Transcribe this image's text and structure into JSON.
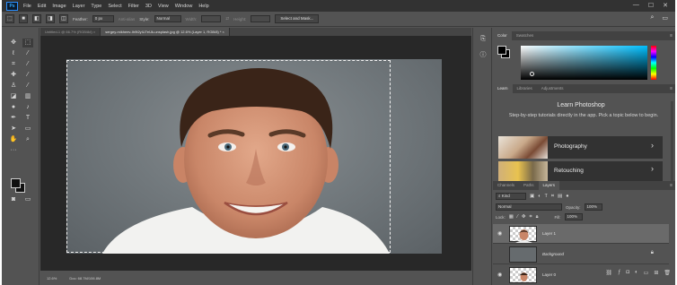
{
  "menubar": {
    "logo": "Ps",
    "items": [
      "File",
      "Edit",
      "Image",
      "Layer",
      "Type",
      "Select",
      "Filter",
      "3D",
      "View",
      "Window",
      "Help"
    ],
    "win_controls": [
      "—",
      "☐",
      "✕"
    ]
  },
  "options": {
    "feather_label": "Feather:",
    "feather_value": "0 px",
    "antialias_label": "Anti-alias",
    "style_label": "Style:",
    "style_value": "Normal",
    "width_label": "Width:",
    "height_label": "Height:",
    "select_mask_label": "Select and Mask..."
  },
  "doc_tabs": [
    "Untitled-1 @ 66.7% (RGB/8#) ×",
    "sergey-mikheev-Ih9t2yIU7eUk-unsplash.jpg @ 12.6% (Layer 1, RGB/8) * ×"
  ],
  "status": {
    "zoom": "12.6%",
    "doc_size": "Doc: 68.7M/106.8M"
  },
  "panels": {
    "color_tabs": [
      "Color",
      "Swatches"
    ],
    "learn_tabs": [
      "Learn",
      "Libraries",
      "Adjustments"
    ],
    "layers_tabs": [
      "Channels",
      "Paths",
      "Layers"
    ],
    "menu_icon": "≡"
  },
  "learn": {
    "title": "Learn Photoshop",
    "description": "Step-by-step tutorials directly in the app. Pick a topic below to begin.",
    "cards": [
      {
        "label": "Photography",
        "chevron": "›"
      },
      {
        "label": "Retouching",
        "chevron": "›"
      }
    ]
  },
  "layers": {
    "kind_label": "Kind",
    "blend_mode": "Normal",
    "opacity_label": "Opacity:",
    "opacity_value": "100%",
    "lock_label": "Lock:",
    "fill_label": "Fill:",
    "fill_value": "100%",
    "items": [
      {
        "name": "Layer 1",
        "selected": true
      },
      {
        "name": "Background",
        "italic": true,
        "locked": true
      },
      {
        "name": "Layer 0",
        "selected": false
      }
    ]
  },
  "colors": {
    "app_bg": "#535353",
    "menubar_bg": "#323232",
    "pasteboard": "#282828",
    "accent_blue": "#31a8ff",
    "selected_layer": "#6a6a6a"
  }
}
